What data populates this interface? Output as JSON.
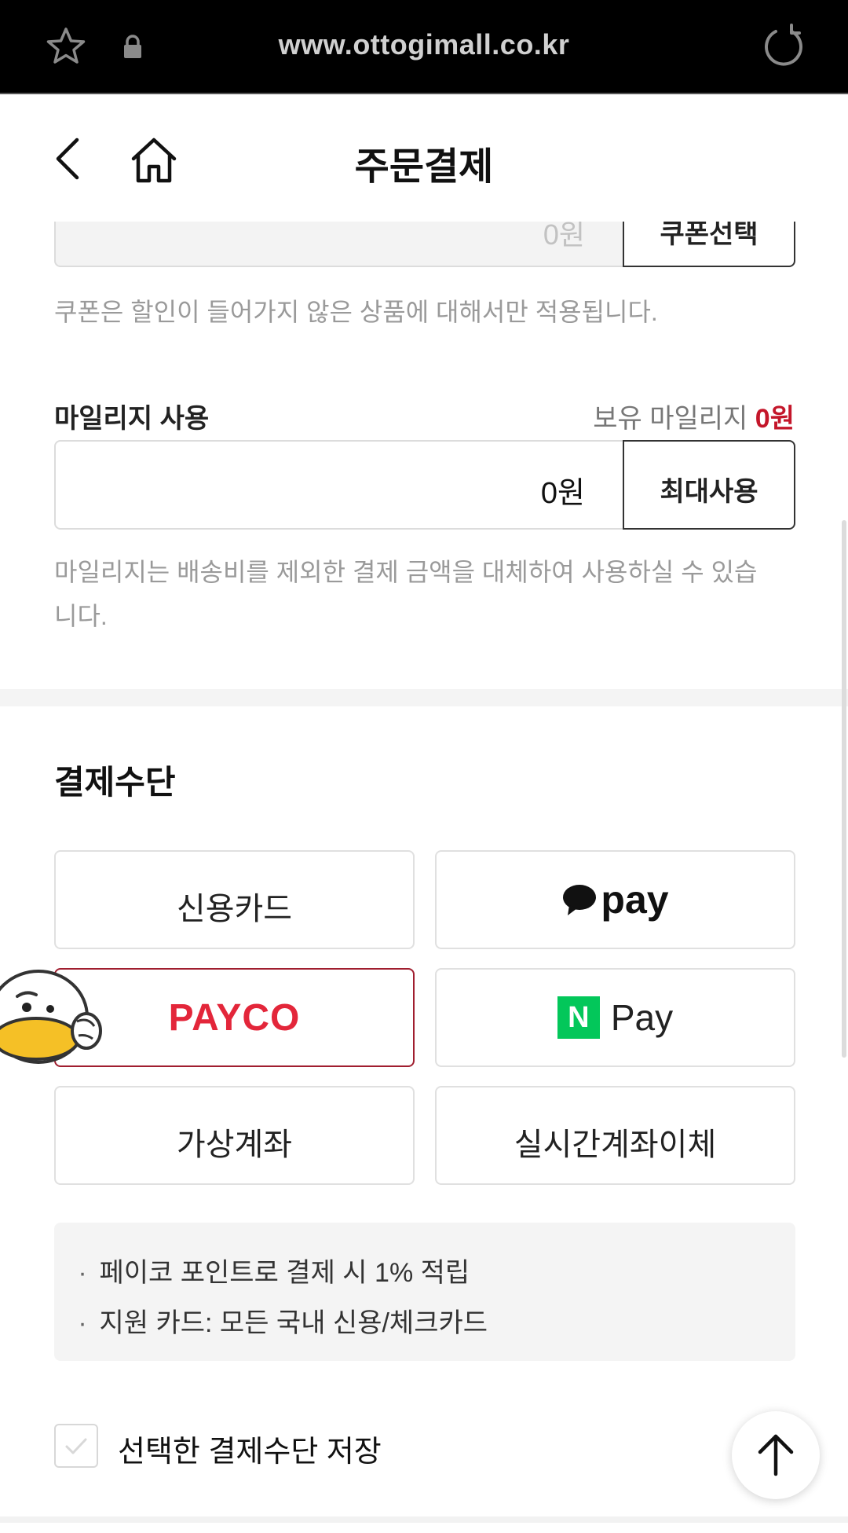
{
  "browser": {
    "url": "www.ottogimall.co.kr"
  },
  "header": {
    "title": "주문결제"
  },
  "coupon": {
    "value": "0원",
    "button_label": "쿠폰선택",
    "note": "쿠폰은 할인이 들어가지 않은 상품에 대해서만 적용됩니다."
  },
  "mileage": {
    "label": "마일리지 사용",
    "owned_label": "보유 마일리지",
    "owned_amount": "0원",
    "value": "0원",
    "button_label": "최대사용",
    "note": "마일리지는 배송비를 제외한 결제 금액을 대체하여 사용하실 수 있습니다."
  },
  "payment": {
    "title": "결제수단",
    "methods": [
      {
        "label": "신용카드",
        "selected": false
      },
      {
        "label": "pay",
        "selected": false
      },
      {
        "label": "PAYCO",
        "selected": true
      },
      {
        "label": "Pay",
        "badge": "N",
        "selected": false
      },
      {
        "label": "가상계좌",
        "selected": false
      },
      {
        "label": "실시간계좌이체",
        "selected": false
      }
    ],
    "info": [
      "페이코 포인트로 결제 시 1% 적립",
      "지원 카드: 모든 국내 신용/체크카드"
    ],
    "save_label": "선택한 결제수단 저장",
    "save_checked": false
  },
  "colors": {
    "accent": "#c4162a",
    "payco": "#e3263a",
    "npay_green": "#03c75a"
  }
}
